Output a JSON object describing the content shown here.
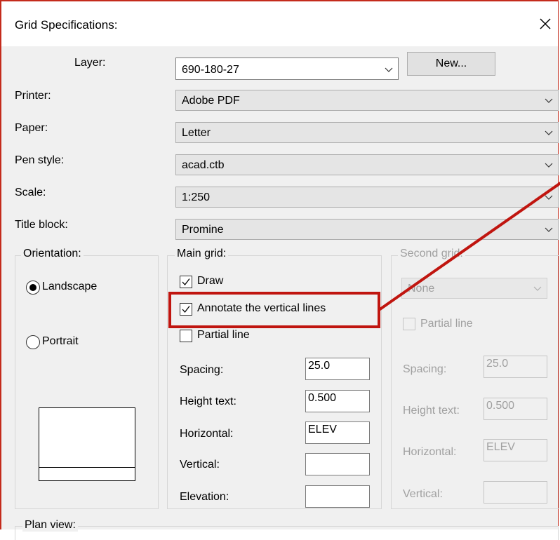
{
  "window": {
    "title": "Grid Specifications:"
  },
  "layer": {
    "label": "Layer:",
    "value": "690-180-27",
    "new_button": "New..."
  },
  "printer": {
    "label": "Printer:",
    "value": "Adobe PDF"
  },
  "paper": {
    "label": "Paper:",
    "value": "Letter"
  },
  "pen_style": {
    "label": "Pen style:",
    "value": "acad.ctb"
  },
  "scale": {
    "label": "Scale:",
    "value": "1:250"
  },
  "title_block": {
    "label": "Title block:",
    "value": "Promine"
  },
  "orientation": {
    "title": "Orientation:",
    "landscape": "Landscape",
    "portrait": "Portrait",
    "selected": "Landscape"
  },
  "main_grid": {
    "title": "Main grid:",
    "draw": {
      "label": "Draw",
      "checked": true
    },
    "annotate": {
      "label": "Annotate the vertical lines",
      "checked": true
    },
    "partial": {
      "label": "Partial line",
      "checked": false
    },
    "spacing": {
      "label": "Spacing:",
      "value": "25.0"
    },
    "height_text": {
      "label": "Height text:",
      "value": "0.500"
    },
    "horizontal": {
      "label": "Horizontal:",
      "value": "ELEV"
    },
    "vertical": {
      "label": "Vertical:",
      "value": ""
    },
    "elevation": {
      "label": "Elevation:",
      "value": ""
    }
  },
  "second_grid": {
    "title": "Second grid:",
    "select_value": "None",
    "partial": {
      "label": "Partial line",
      "checked": false
    },
    "spacing": {
      "label": "Spacing:",
      "value": "25.0"
    },
    "height_text": {
      "label": "Height text:",
      "value": "0.500"
    },
    "horizontal": {
      "label": "Horizontal:",
      "value": "ELEV"
    },
    "vertical": {
      "label": "Vertical:",
      "value": ""
    }
  },
  "plan_view": {
    "title": "Plan view:"
  },
  "colors": {
    "highlight": "#c0150f",
    "border": "#c42b1c",
    "dialog_bg": "#f0f0f0"
  }
}
